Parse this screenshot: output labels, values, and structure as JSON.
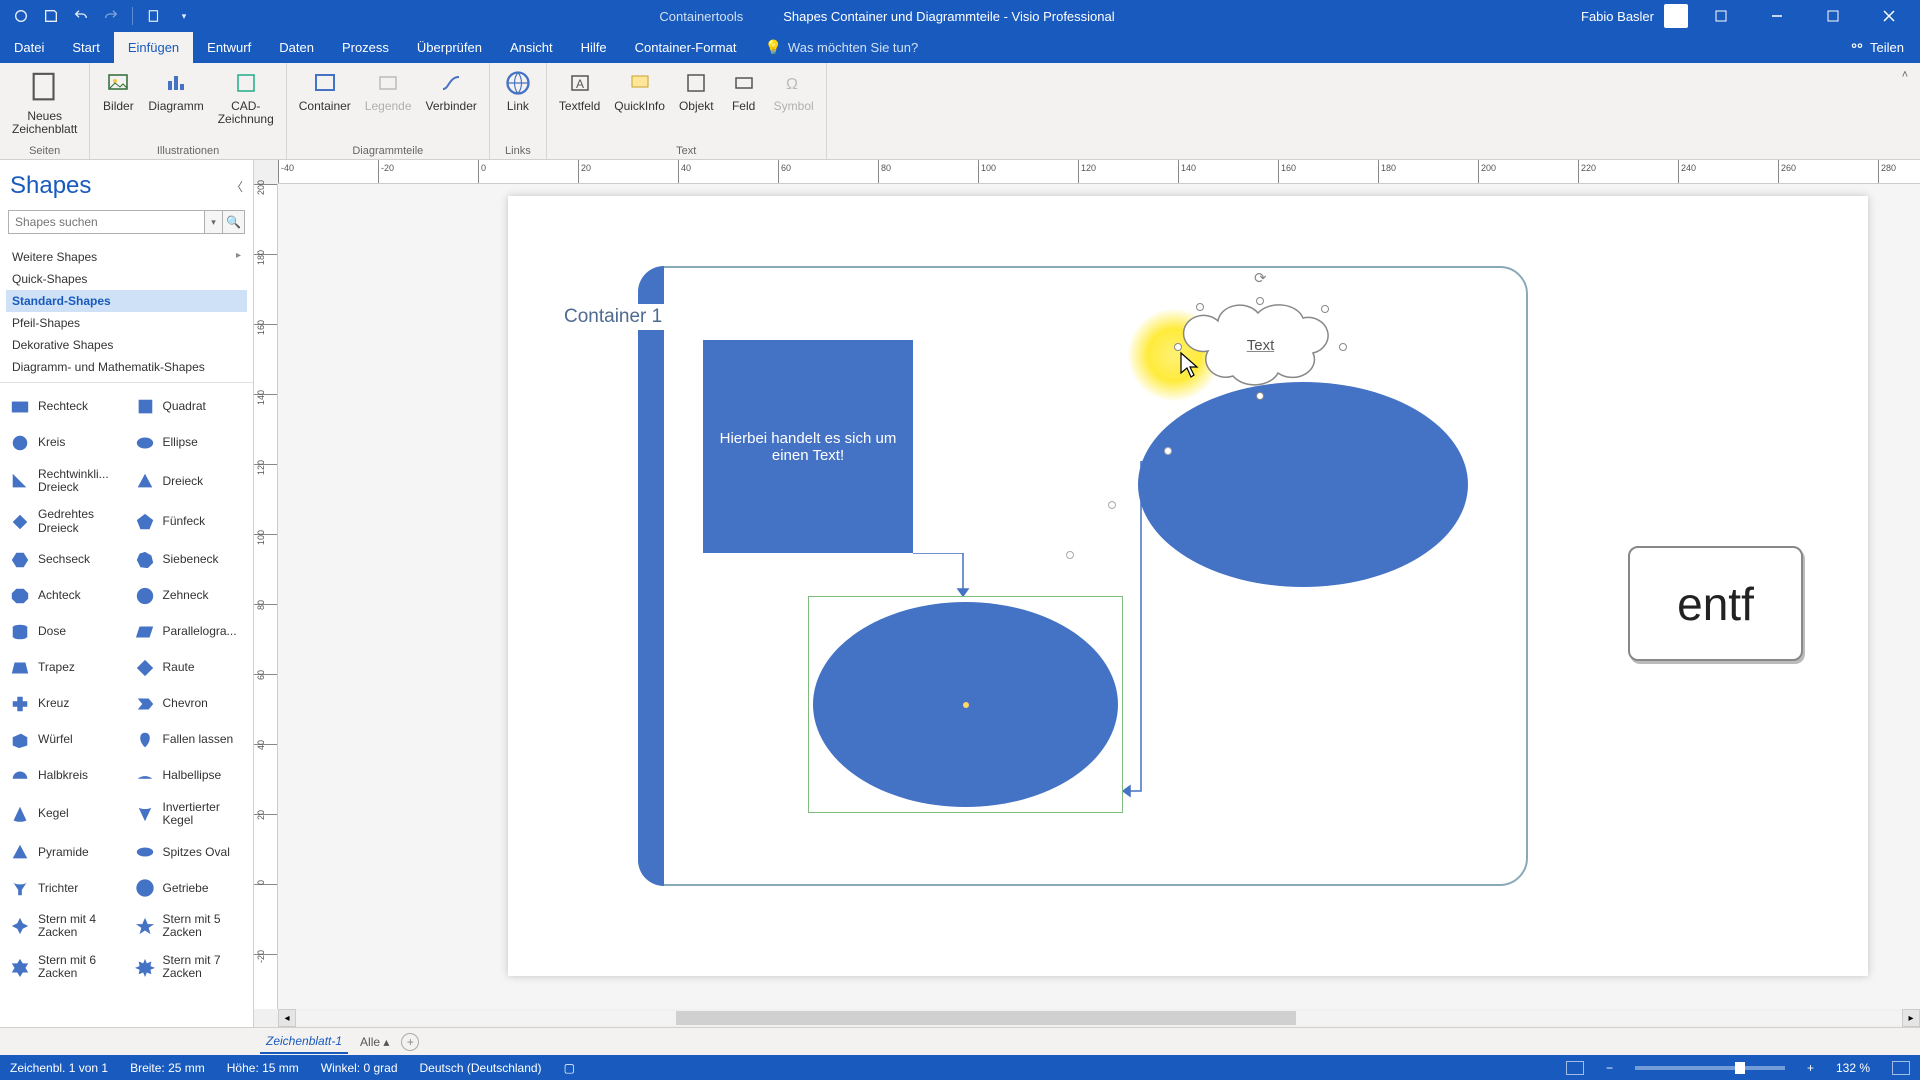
{
  "titlebar": {
    "context_label": "Containertools",
    "document_title": "Shapes Container und Diagrammteile - Visio Professional",
    "user_name": "Fabio Basler"
  },
  "menu": {
    "tabs": [
      "Datei",
      "Start",
      "Einfügen",
      "Entwurf",
      "Daten",
      "Prozess",
      "Überprüfen",
      "Ansicht",
      "Hilfe",
      "Container-Format"
    ],
    "active_index": 2,
    "tellme_placeholder": "Was möchten Sie tun?",
    "share_label": "Teilen"
  },
  "ribbon": {
    "groups": [
      {
        "label": "Seiten",
        "items": [
          {
            "label": "Neues\nZeichenblatt",
            "big": true
          }
        ]
      },
      {
        "label": "Illustrationen",
        "items": [
          {
            "label": "Bilder"
          },
          {
            "label": "Diagramm"
          },
          {
            "label": "CAD-\nZeichnung"
          }
        ]
      },
      {
        "label": "Diagrammteile",
        "items": [
          {
            "label": "Container"
          },
          {
            "label": "Legende",
            "disabled": true
          },
          {
            "label": "Verbinder"
          }
        ]
      },
      {
        "label": "Links",
        "items": [
          {
            "label": "Link"
          }
        ]
      },
      {
        "label": "Text",
        "items": [
          {
            "label": "Textfeld"
          },
          {
            "label": "QuickInfo"
          },
          {
            "label": "Objekt"
          },
          {
            "label": "Feld"
          },
          {
            "label": "Symbol",
            "disabled": true
          }
        ]
      }
    ]
  },
  "shapes_panel": {
    "title": "Shapes",
    "search_placeholder": "Shapes suchen",
    "categories": [
      {
        "label": "Weitere Shapes",
        "has_arrow": true
      },
      {
        "label": "Quick-Shapes"
      },
      {
        "label": "Standard-Shapes",
        "active": true
      },
      {
        "label": "Pfeil-Shapes"
      },
      {
        "label": "Dekorative Shapes"
      },
      {
        "label": "Diagramm- und Mathematik-Shapes"
      }
    ],
    "shapes": [
      {
        "l": "Rechteck",
        "r": "Quadrat"
      },
      {
        "l": "Kreis",
        "r": "Ellipse"
      },
      {
        "l": "Rechtwinkli...\nDreieck",
        "r": "Dreieck"
      },
      {
        "l": "Gedrehtes\nDreieck",
        "r": "Fünfeck"
      },
      {
        "l": "Sechseck",
        "r": "Siebeneck"
      },
      {
        "l": "Achteck",
        "r": "Zehneck"
      },
      {
        "l": "Dose",
        "r": "Parallelogra..."
      },
      {
        "l": "Trapez",
        "r": "Raute"
      },
      {
        "l": "Kreuz",
        "r": "Chevron"
      },
      {
        "l": "Würfel",
        "r": "Fallen lassen"
      },
      {
        "l": "Halbkreis",
        "r": "Halbellipse"
      },
      {
        "l": "Kegel",
        "r": "Invertierter\nKegel"
      },
      {
        "l": "Pyramide",
        "r": "Spitzes Oval"
      },
      {
        "l": "Trichter",
        "r": "Getriebe"
      },
      {
        "l": "Stern mit 4\nZacken",
        "r": "Stern mit 5\nZacken"
      },
      {
        "l": "Stern mit 6\nZacken",
        "r": "Stern mit 7\nZacken"
      }
    ]
  },
  "ruler_h_ticks": [
    "-40",
    "-20",
    "0",
    "20",
    "40",
    "60",
    "80",
    "100",
    "120",
    "140",
    "160",
    "180",
    "200",
    "220",
    "240",
    "260",
    "280"
  ],
  "ruler_v_ticks": [
    "200",
    "180",
    "160",
    "140",
    "120",
    "100",
    "80",
    "60",
    "40",
    "20",
    "0",
    "-20"
  ],
  "canvas": {
    "container_label": "Container 1",
    "rect_text": "Hierbei handelt es sich um einen Text!",
    "cloud_text": "Text",
    "entf_label": "entf"
  },
  "sheet_tabs": {
    "active": "Zeichenblatt-1",
    "all_label": "Alle"
  },
  "status": {
    "page_info": "Zeichenbl. 1 von 1",
    "width": "Breite: 25 mm",
    "height": "Höhe: 15 mm",
    "angle": "Winkel: 0 grad",
    "language": "Deutsch (Deutschland)",
    "zoom": "132 %"
  }
}
